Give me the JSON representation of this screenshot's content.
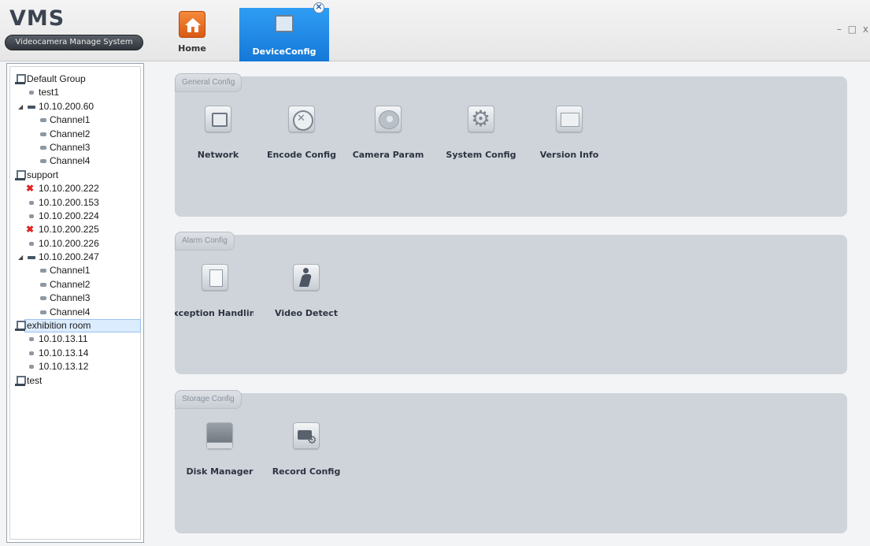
{
  "header": {
    "logo_title": "VMS",
    "logo_subtitle": "Videocamera Manage System",
    "window_controls": "– □ x"
  },
  "tabs": [
    {
      "label": "Home",
      "icon": "home-icon",
      "active": false
    },
    {
      "label": "DeviceConfig",
      "icon": "device-config-icon",
      "active": true
    }
  ],
  "tree": {
    "rows": [
      {
        "label": "Default Group"
      },
      {
        "label": "test1"
      },
      {
        "label": "10.10.200.60"
      },
      {
        "label": "Channel1"
      },
      {
        "label": "Channel2"
      },
      {
        "label": "Channel3"
      },
      {
        "label": "Channel4"
      },
      {
        "label": "support"
      },
      {
        "label": "10.10.200.222"
      },
      {
        "label": "10.10.200.153"
      },
      {
        "label": "10.10.200.224"
      },
      {
        "label": "10.10.200.225"
      },
      {
        "label": "10.10.200.226"
      },
      {
        "label": "10.10.200.247"
      },
      {
        "label": "Channel1"
      },
      {
        "label": "Channel2"
      },
      {
        "label": "Channel3"
      },
      {
        "label": "Channel4"
      },
      {
        "label": "exhibition room"
      },
      {
        "label": "10.10.13.11"
      },
      {
        "label": "10.10.13.14"
      },
      {
        "label": "10.10.13.12"
      },
      {
        "label": "test"
      }
    ]
  },
  "panels": {
    "general": {
      "title": "General Config",
      "items": [
        {
          "label": "Network",
          "icon": "network-icon"
        },
        {
          "label": "Encode Config",
          "icon": "encode-icon"
        },
        {
          "label": "Camera Param",
          "icon": "camera-icon"
        },
        {
          "label": "System Config",
          "icon": "gear-icon"
        },
        {
          "label": "Version Info",
          "icon": "info-icon"
        }
      ]
    },
    "alarm": {
      "title": "Alarm Config",
      "items": [
        {
          "label": "Exception Handling",
          "icon": "document-warning-icon"
        },
        {
          "label": "Video Detect",
          "icon": "motion-icon"
        }
      ]
    },
    "storage": {
      "title": "Storage Config",
      "items": [
        {
          "label": "Disk Manager",
          "icon": "disk-icon"
        },
        {
          "label": "Record Config",
          "icon": "record-settings-icon"
        }
      ]
    }
  }
}
